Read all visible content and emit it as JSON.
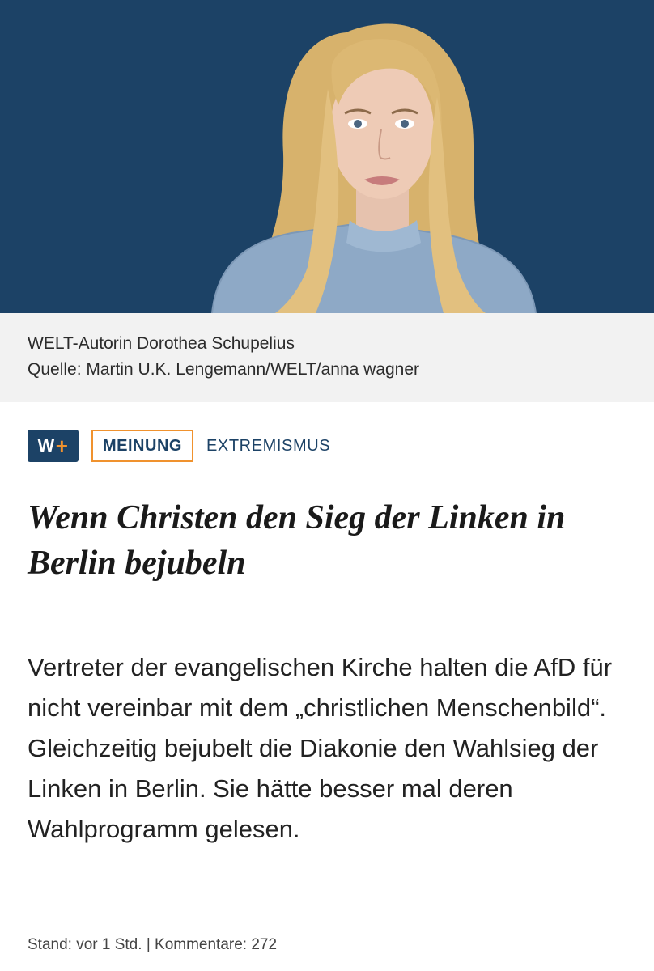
{
  "hero": {
    "image": "portrait-photo",
    "background_color": "#1c4266"
  },
  "caption": {
    "text": "WELT-Autorin Dorothea Schupelius",
    "source": "Quelle: Martin U.K. Lengemann/WELT/anna wagner"
  },
  "tags": {
    "premium_letter": "W",
    "premium_plus": "+",
    "category": "MEINUNG",
    "section": "EXTREMISMUS",
    "accent_color": "#f0922e",
    "brand_color": "#1c4266"
  },
  "article": {
    "headline": "Wenn Christen den Sieg der Linken in Berlin bejubeln",
    "intro": "Vertreter der evangelischen Kirche halten die AfD für nicht vereinbar mit dem „christlichen Menschenbild“. Gleichzeitig bejubelt die Diakonie den Wahlsieg der Linken in Berlin. Sie hätte besser mal deren Wahlprogramm gelesen."
  },
  "meta": {
    "stand": "Stand: vor 1 Std.",
    "separator": "|",
    "comments_label": "Kommentare:",
    "comments_count": "272"
  }
}
